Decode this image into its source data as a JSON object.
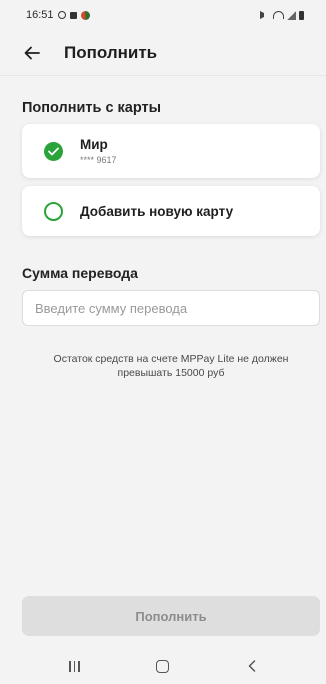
{
  "status_bar": {
    "time": "16:51"
  },
  "header": {
    "title": "Пополнить"
  },
  "card_section": {
    "title": "Пополнить с карты",
    "cards": [
      {
        "name": "Мир",
        "masked_number": "**** 9617",
        "selected": true
      }
    ],
    "add_card_label": "Добавить новую карту"
  },
  "amount": {
    "title": "Сумма перевода",
    "placeholder": "Введите сумму перевода",
    "value": ""
  },
  "note": {
    "line1": "Остаток средств на счете MPPay Lite не должен",
    "line2": "превышать 15000 руб"
  },
  "submit": {
    "label": "Пополнить",
    "enabled": false
  },
  "colors": {
    "accent": "#2aa33b",
    "background": "#f3f3f3",
    "button_disabled": "#dedede"
  },
  "icons": {
    "back": "arrow-left-icon",
    "selected_radio": "check-circle-icon",
    "unselected_radio": "circle-outline-icon",
    "nav_recents": "recents-icon",
    "nav_home": "home-icon",
    "nav_back": "chevron-left-icon"
  }
}
